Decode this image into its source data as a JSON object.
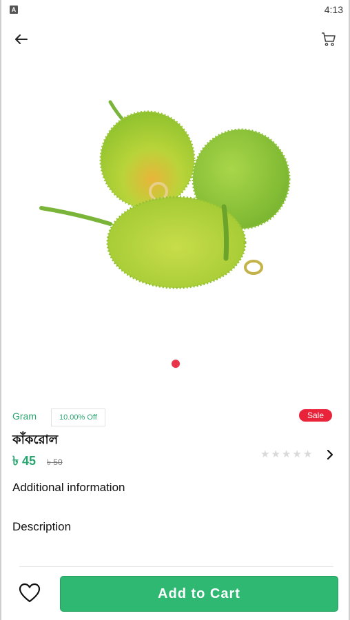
{
  "status_bar": {
    "app_icon_letter": "A",
    "time": "4:13"
  },
  "top_bar": {
    "back_icon": "arrow-left-icon",
    "cart_icon": "shopping-cart-icon"
  },
  "product": {
    "image_icon": "kakrol-gourd-image",
    "carousel": {
      "active_index": 0,
      "dot_color": "#e8334a"
    },
    "unit": "Gram",
    "discount_label": "10.00% Off",
    "sale_badge": "Sale",
    "name": "কাঁকরোল",
    "price": "৳ 45",
    "old_price": "৳ 50",
    "rating": {
      "value": 0,
      "max": 5
    }
  },
  "sections": {
    "additional_information": "Additional information",
    "description": "Description"
  },
  "bottom_bar": {
    "wishlist_icon": "heart-icon",
    "add_to_cart_label": "Add to Cart"
  },
  "colors": {
    "accent_green": "#2eb872",
    "text_green": "#2aa571",
    "sale_red": "#e8233a"
  }
}
